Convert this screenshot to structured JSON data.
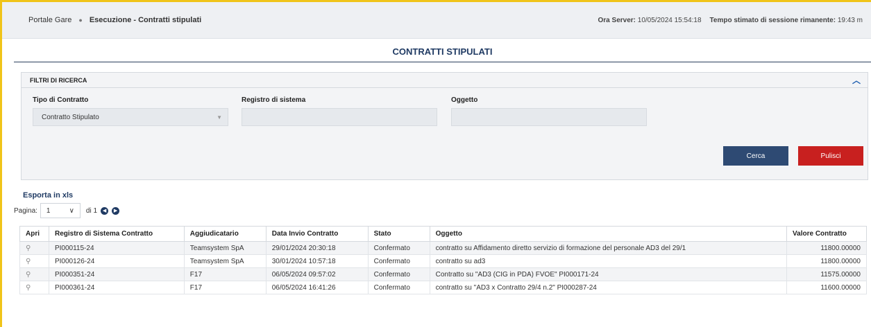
{
  "header": {
    "breadcrumb": [
      "Portale Gare",
      "Esecuzione - Contratti stipulati"
    ],
    "separator_icon": "bullet-icon",
    "server_label": "Ora Server:",
    "server_time": "10/05/2024 15:54:18",
    "session_label": "Tempo stimato di sessione rimanente:",
    "session_time": "19:43 m"
  },
  "page": {
    "title": "CONTRATTI STIPULATI"
  },
  "filters": {
    "title": "FILTRI DI RICERCA",
    "collapse_icon": "chevron-up-icon",
    "fields": [
      {
        "label": "Tipo di Contratto",
        "value": "Contratto Stipulato"
      },
      {
        "label": "Registro di sistema",
        "value": ""
      },
      {
        "label": "Oggetto",
        "value": ""
      }
    ],
    "search_label": "Cerca",
    "clear_label": "Pulisci"
  },
  "export_label": "Esporta in xls",
  "pager": {
    "label": "Pagina:",
    "current": "1",
    "of": "di 1"
  },
  "table": {
    "headers": [
      "Apri",
      "Registro di Sistema Contratto",
      "Aggiudicatario",
      "Data Invio Contratto",
      "Stato",
      "Oggetto",
      "Valore Contratto"
    ],
    "rows": [
      [
        "PI000115-24",
        "Teamsystem SpA",
        "29/01/2024 20:30:18",
        "Confermato",
        "contratto su Affidamento diretto servizio di formazione del personale AD3 del 29/1",
        "11800.00000"
      ],
      [
        "PI000126-24",
        "Teamsystem SpA",
        "30/01/2024 10:57:18",
        "Confermato",
        "contratto su ad3",
        "11800.00000"
      ],
      [
        "PI000351-24",
        "F17",
        "06/05/2024 09:57:02",
        "Confermato",
        "Contratto su \"AD3 (CIG in PDA) FVOE\" PI000171-24",
        "11575.00000"
      ],
      [
        "PI000361-24",
        "F17",
        "06/05/2024 16:41:26",
        "Confermato",
        "contratto su \"AD3 x Contratto 29/4 n.2\" PI000287-24",
        "11600.00000"
      ]
    ]
  }
}
